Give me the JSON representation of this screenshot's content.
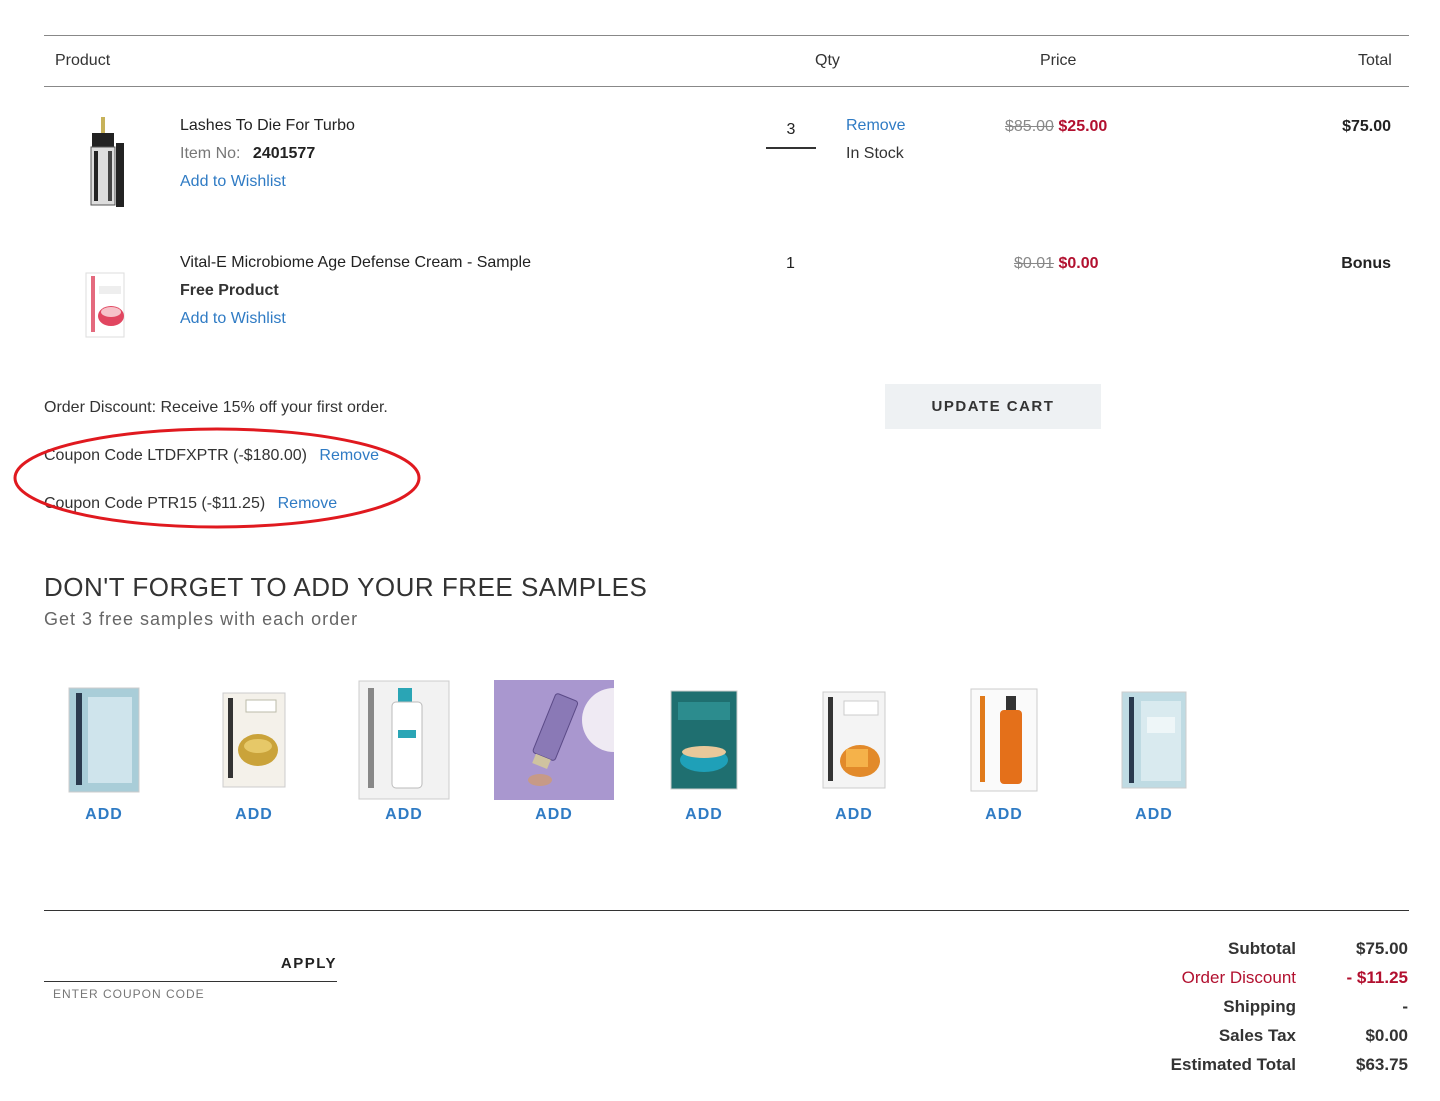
{
  "table": {
    "headers": {
      "product": "Product",
      "qty": "Qty",
      "price": "Price",
      "total": "Total"
    }
  },
  "items": [
    {
      "name": "Lashes To Die For Turbo",
      "item_no_label": "Item No:",
      "item_no": "2401577",
      "wishlist": "Add to Wishlist",
      "qty": "3",
      "remove": "Remove",
      "stock": "In Stock",
      "old_price": "$85.00",
      "price": "$25.00",
      "total": "$75.00"
    },
    {
      "name": "Vital-E Microbiome Age Defense Cream - Sample",
      "free_label": "Free Product",
      "wishlist": "Add to Wishlist",
      "qty": "1",
      "old_price": "$0.01",
      "price": "$0.00",
      "total": "Bonus"
    }
  ],
  "order_discount": "Order Discount: Receive 15% off your first order.",
  "update_cart": "UPDATE CART",
  "coupons": [
    {
      "text": "Coupon Code LTDFXPTR (-$180.00)",
      "remove": "Remove"
    },
    {
      "text": "Coupon Code PTR15 (-$11.25)",
      "remove": "Remove"
    }
  ],
  "samples": {
    "title": "DON'T FORGET TO ADD YOUR FREE SAMPLES",
    "subtitle": "Get 3 free samples with each order",
    "add_label": "ADD",
    "icons": [
      "sample-packet-icon",
      "eye-patch-sample-icon",
      "serum-sample-icon",
      "tube-sample-icon",
      "cream-sample-icon",
      "mask-sample-icon",
      "cleansing-gel-sample-icon",
      "moisturizer-sample-icon"
    ]
  },
  "coupon_form": {
    "apply": "APPLY",
    "placeholder": "ENTER COUPON CODE"
  },
  "summary": {
    "subtotal_label": "Subtotal",
    "subtotal": "$75.00",
    "discount_label": "Order Discount",
    "discount": "- $11.25",
    "shipping_label": "Shipping",
    "shipping": "-",
    "tax_label": "Sales Tax",
    "tax": "$0.00",
    "total_label": "Estimated Total",
    "total": "$63.75"
  },
  "colors": {
    "link": "#2f7bc4",
    "sale": "#b2102f",
    "highlight": "#e0191f"
  }
}
